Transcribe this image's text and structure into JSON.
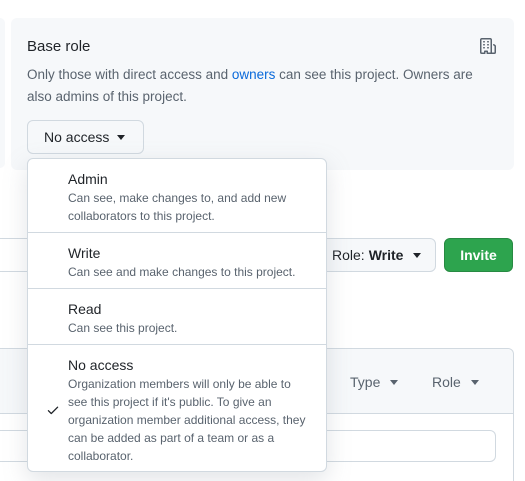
{
  "base_role": {
    "title": "Base role",
    "desc_prefix": "Only those with direct access and ",
    "owners_link": "owners",
    "desc_suffix": " can see this project. Owners are also admins of this project.",
    "button_label": "No access",
    "icon": "organization-icon"
  },
  "role_selector": {
    "prefix": "Role:",
    "value": "Write"
  },
  "invite_button": "Invite",
  "table": {
    "type_header": "Type",
    "role_header": "Role"
  },
  "menu": {
    "items": [
      {
        "title": "Admin",
        "description": "Can see, make changes to, and add new collaborators to this project.",
        "selected": false
      },
      {
        "title": "Write",
        "description": "Can see and make changes to this project.",
        "selected": false
      },
      {
        "title": "Read",
        "description": "Can see this project.",
        "selected": false
      },
      {
        "title": "No access",
        "description": "Organization members will only be able to see this project if it's public. To give an organization member additional access, they can be added as part of a team or as a collaborator.",
        "selected": true
      }
    ]
  },
  "colors": {
    "accent_link": "#0969da",
    "invite_green": "#2da44e",
    "panel_bg": "#f6f8fa",
    "border": "#d1d9e0"
  }
}
